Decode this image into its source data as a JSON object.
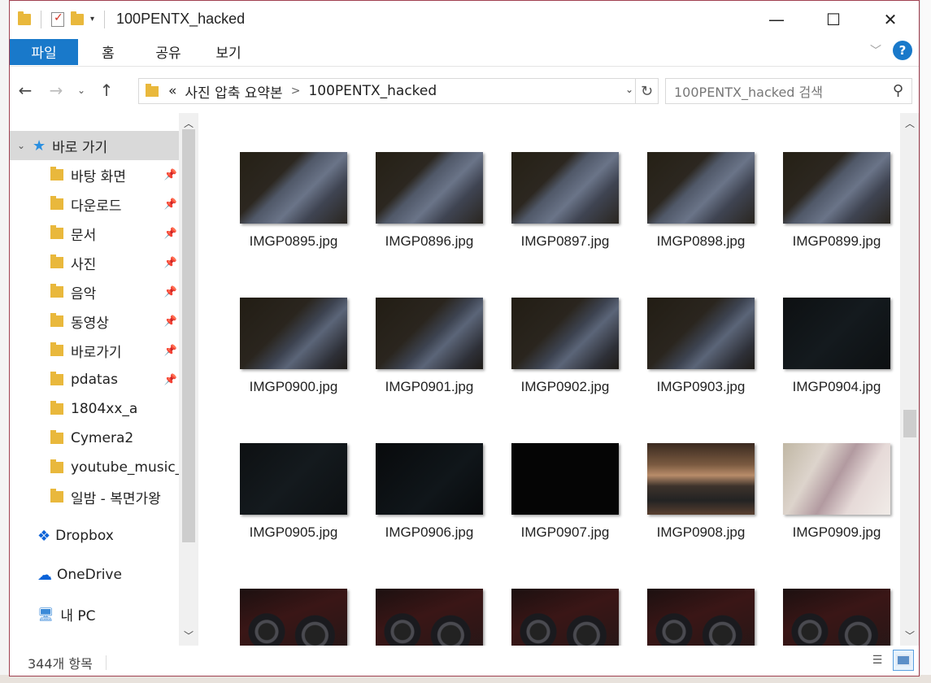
{
  "window": {
    "title": "100PENTX_hacked",
    "controls": {
      "minimize": "—",
      "maximize": "☐",
      "close": "✕"
    }
  },
  "ribbon": {
    "tabs": [
      "파일",
      "홈",
      "공유",
      "보기"
    ],
    "help": "?"
  },
  "nav": {
    "address": {
      "overflow": "«",
      "crumbs": [
        "사진 압축 요약본",
        "100PENTX_hacked"
      ],
      "separator": ">"
    },
    "search_placeholder": "100PENTX_hacked 검색"
  },
  "sidebar": {
    "quick_access": "바로 가기",
    "items": [
      {
        "label": "바탕 화면",
        "icon": "desktop-folder-icon",
        "pinned": true
      },
      {
        "label": "다운로드",
        "icon": "download-folder-icon",
        "pinned": true
      },
      {
        "label": "문서",
        "icon": "documents-folder-icon",
        "pinned": true
      },
      {
        "label": "사진",
        "icon": "pictures-folder-icon",
        "pinned": true
      },
      {
        "label": "음악",
        "icon": "music-folder-icon",
        "pinned": true
      },
      {
        "label": "동영상",
        "icon": "videos-folder-icon",
        "pinned": true
      },
      {
        "label": "바로가기",
        "icon": "folder-icon",
        "pinned": true
      },
      {
        "label": "pdatas",
        "icon": "folder-icon",
        "pinned": true
      },
      {
        "label": "1804xx_a",
        "icon": "synced-folder-icon",
        "pinned": false
      },
      {
        "label": "Cymera2",
        "icon": "folder-icon",
        "pinned": false
      },
      {
        "label": "youtube_music_",
        "icon": "folder-icon",
        "pinned": false
      },
      {
        "label": "일밤 - 복면가왕",
        "icon": "folder-icon",
        "pinned": false
      }
    ],
    "dropbox": "Dropbox",
    "onedrive": "OneDrive",
    "this_pc": "내 PC"
  },
  "files": [
    {
      "name": "IMGP0895.jpg",
      "style": "dark1"
    },
    {
      "name": "IMGP0896.jpg",
      "style": "dark1"
    },
    {
      "name": "IMGP0897.jpg",
      "style": "dark1"
    },
    {
      "name": "IMGP0898.jpg",
      "style": "dark1"
    },
    {
      "name": "IMGP0899.jpg",
      "style": "dark1"
    },
    {
      "name": "IMGP0900.jpg",
      "style": "dark2"
    },
    {
      "name": "IMGP0901.jpg",
      "style": "dark2"
    },
    {
      "name": "IMGP0902.jpg",
      "style": "dark2"
    },
    {
      "name": "IMGP0903.jpg",
      "style": "dark2"
    },
    {
      "name": "IMGP0904.jpg",
      "style": "black1"
    },
    {
      "name": "IMGP0905.jpg",
      "style": "black1"
    },
    {
      "name": "IMGP0906.jpg",
      "style": "black2"
    },
    {
      "name": "IMGP0907.jpg",
      "style": "black3"
    },
    {
      "name": "IMGP0908.jpg",
      "style": "bag"
    },
    {
      "name": "IMGP0909.jpg",
      "style": "bright"
    },
    {
      "name": "",
      "style": "lens"
    },
    {
      "name": "",
      "style": "lens"
    },
    {
      "name": "",
      "style": "lens"
    },
    {
      "name": "",
      "style": "lens"
    },
    {
      "name": "",
      "style": "lens"
    }
  ],
  "status": {
    "item_count": "344개 항목"
  }
}
